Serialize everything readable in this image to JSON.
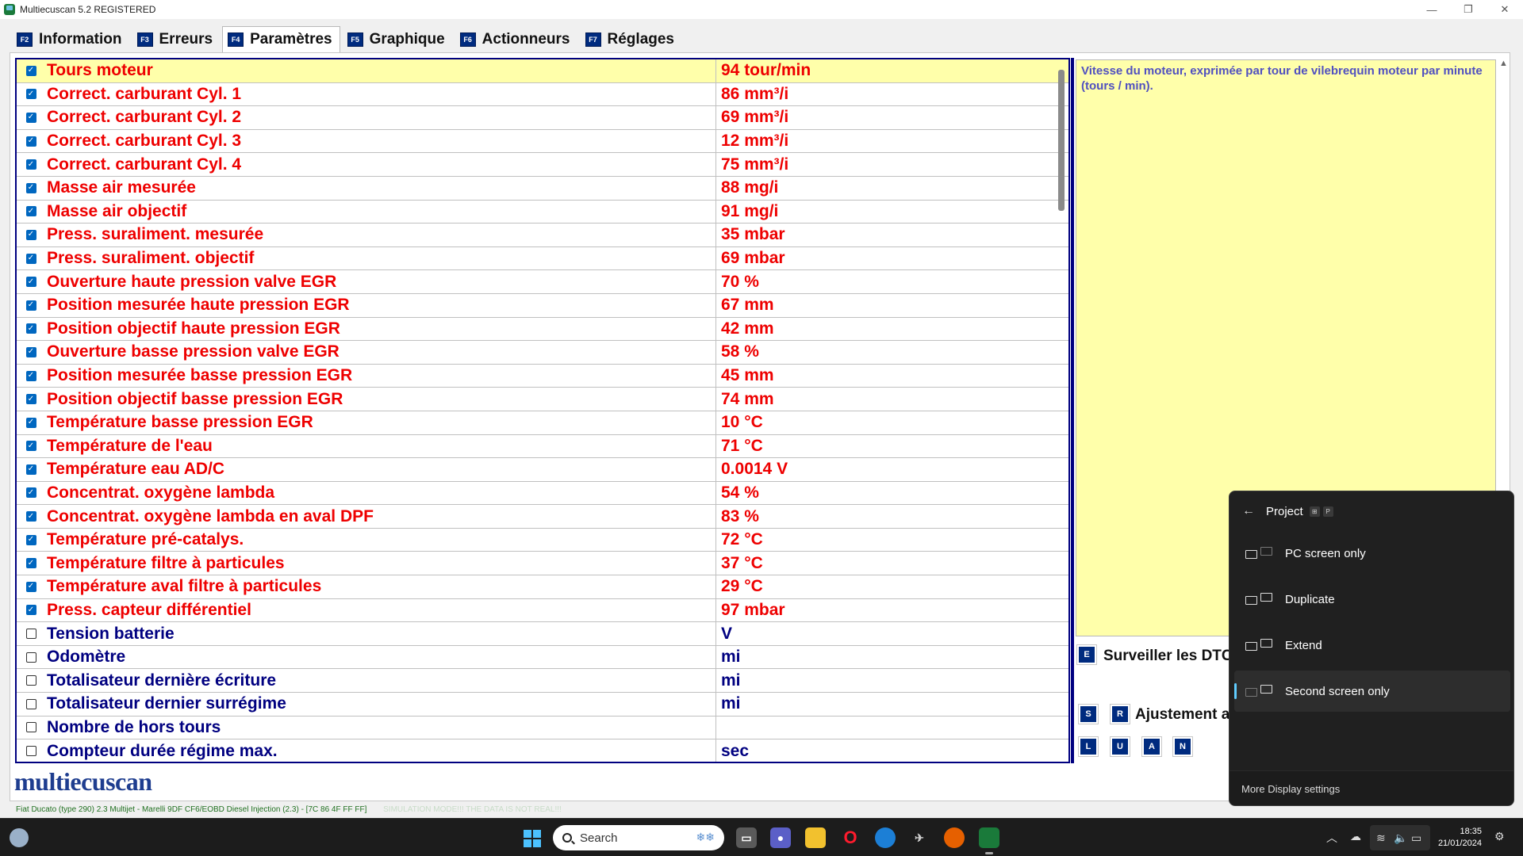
{
  "window": {
    "title": "Multiecuscan 5.2 REGISTERED",
    "minimize": "—",
    "restore": "❐",
    "close": "✕"
  },
  "tabs": [
    {
      "key": "F2",
      "label": "Information"
    },
    {
      "key": "F3",
      "label": "Erreurs"
    },
    {
      "key": "F4",
      "label": "Paramètres"
    },
    {
      "key": "F5",
      "label": "Graphique"
    },
    {
      "key": "F6",
      "label": "Actionneurs"
    },
    {
      "key": "F7",
      "label": "Réglages"
    }
  ],
  "params": [
    {
      "name": "Tours moteur",
      "value": "94 tour/min",
      "checked": true
    },
    {
      "name": "Correct. carburant Cyl. 1",
      "value": "86 mm³/i",
      "checked": true
    },
    {
      "name": "Correct. carburant Cyl. 2",
      "value": "69 mm³/i",
      "checked": true
    },
    {
      "name": "Correct. carburant Cyl. 3",
      "value": "12 mm³/i",
      "checked": true
    },
    {
      "name": "Correct. carburant Cyl. 4",
      "value": "75 mm³/i",
      "checked": true
    },
    {
      "name": "Masse air mesurée",
      "value": "88 mg/i",
      "checked": true
    },
    {
      "name": "Masse air objectif",
      "value": "91 mg/i",
      "checked": true
    },
    {
      "name": "Press. suraliment. mesurée",
      "value": "35 mbar",
      "checked": true
    },
    {
      "name": "Press. suraliment. objectif",
      "value": "69 mbar",
      "checked": true
    },
    {
      "name": "Ouverture haute pression valve EGR",
      "value": "70 %",
      "checked": true
    },
    {
      "name": "Position mesurée haute pression EGR",
      "value": "67 mm",
      "checked": true
    },
    {
      "name": "Position objectif haute pression EGR",
      "value": "42 mm",
      "checked": true
    },
    {
      "name": "Ouverture basse pression valve EGR",
      "value": "58 %",
      "checked": true
    },
    {
      "name": "Position mesurée basse pression EGR",
      "value": "45 mm",
      "checked": true
    },
    {
      "name": "Position objectif basse pression EGR",
      "value": "74 mm",
      "checked": true
    },
    {
      "name": "Température basse pression EGR",
      "value": "10 °C",
      "checked": true
    },
    {
      "name": "Température de l'eau",
      "value": "71 °C",
      "checked": true
    },
    {
      "name": "Température eau AD/C",
      "value": "0.0014 V",
      "checked": true
    },
    {
      "name": "Concentrat. oxygène lambda",
      "value": "54 %",
      "checked": true
    },
    {
      "name": "Concentrat. oxygène lambda en aval DPF",
      "value": "83 %",
      "checked": true
    },
    {
      "name": "Température pré-catalys.",
      "value": "72 °C",
      "checked": true
    },
    {
      "name": "Température filtre à particules",
      "value": "37 °C",
      "checked": true
    },
    {
      "name": "Température aval filtre à particules",
      "value": "29 °C",
      "checked": true
    },
    {
      "name": "Press. capteur différentiel",
      "value": "97 mbar",
      "checked": true
    },
    {
      "name": "Tension batterie",
      "value": " V",
      "checked": false
    },
    {
      "name": "Odomètre",
      "value": " mi",
      "checked": false
    },
    {
      "name": "Totalisateur dernière écriture",
      "value": " mi",
      "checked": false
    },
    {
      "name": "Totalisateur dernier surrégime",
      "value": " mi",
      "checked": false
    },
    {
      "name": "Nombre de hors tours",
      "value": "",
      "checked": false
    },
    {
      "name": "Compteur durée régime max.",
      "value": "sec",
      "checked": false
    }
  ],
  "description": "Vitesse du moteur, exprimée par tour de vilebrequin moteur par minute (tours / min).",
  "side_buttons": {
    "monitor_key": "E",
    "monitor_label": "Surveiller les DTC",
    "s_key": "S",
    "r_key": "R",
    "adjust_label": "Ajustement a",
    "l_key": "L",
    "u_key": "U",
    "a_key": "A",
    "n_key": "N"
  },
  "logo": "multiecuscan",
  "status": {
    "vehicle": "Fiat Ducato (type 290) 2.3 Multijet - Marelli 9DF CF6/EOBD Diesel Injection (2.3) - [7C 86 4F FF FF]",
    "simulation": "SIMULATION MODE!!! THE DATA IS NOT REAL!!!"
  },
  "project_flyout": {
    "back": "←",
    "title": "Project",
    "shortcut_key": "P",
    "options": [
      "PC screen only",
      "Duplicate",
      "Extend",
      "Second screen only"
    ],
    "selected": "Second screen only",
    "footer": "More Display settings"
  },
  "taskbar": {
    "search_placeholder": "Search",
    "time": "18:35",
    "date": "21/01/2024"
  }
}
